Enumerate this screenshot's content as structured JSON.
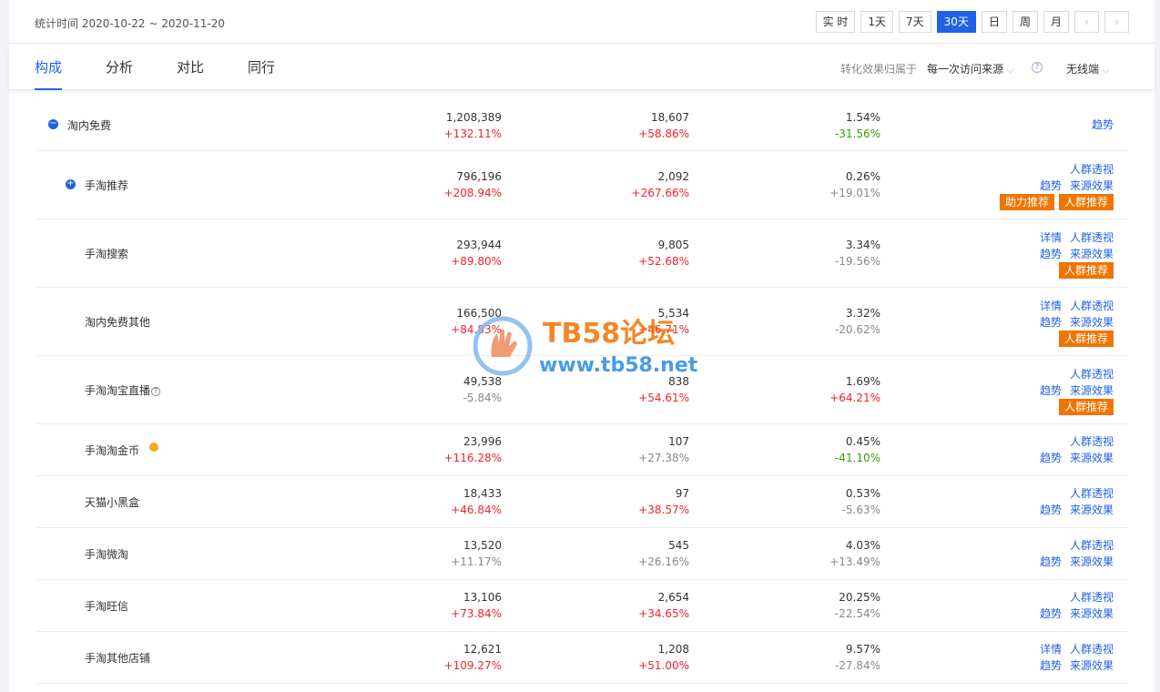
{
  "header": {
    "date_range": "统计时间 2020-10-22 ~ 2020-11-20",
    "range_buttons": [
      {
        "label": "实 时",
        "active": false
      },
      {
        "label": "1天",
        "active": false
      },
      {
        "label": "7天",
        "active": false
      },
      {
        "label": "30天",
        "active": true
      },
      {
        "label": "日",
        "active": false
      },
      {
        "label": "周",
        "active": false
      },
      {
        "label": "月",
        "active": false
      }
    ],
    "prev_icon": "‹",
    "next_icon": "›"
  },
  "tabs": [
    "构成",
    "分析",
    "对比",
    "同行"
  ],
  "attribution": {
    "label": "转化效果归属于",
    "value": "每一次访问来源",
    "device": "无线端"
  },
  "rows": [
    {
      "name": "淘内免费",
      "toggle": "−",
      "v1": "1,208,389",
      "c1": "+132.11%",
      "v2": "18,607",
      "c2": "+58.86%",
      "v3": "1.54%",
      "c3": "-31.56%"
    },
    {
      "name": "手淘推荐",
      "toggle": "+",
      "v1": "796,196",
      "c1": "+208.94%",
      "v2": "2,092",
      "c2": "+267.66%",
      "v3": "0.26%",
      "c3": "+19.01%"
    },
    {
      "name": "手淘搜索",
      "v1": "293,944",
      "c1": "+89.80%",
      "v2": "9,805",
      "c2": "+52.68%",
      "v3": "3.34%",
      "c3": "-19.56%"
    },
    {
      "name": "淘内免费其他",
      "v1": "166,500",
      "c1": "+84.83%",
      "v2": "5,534",
      "c2": "+46.71%",
      "v3": "3.32%",
      "c3": "-20.62%"
    },
    {
      "name": "手淘淘宝直播",
      "v1": "49,538",
      "c1": "-5.84%",
      "v2": "838",
      "c2": "+54.61%",
      "v3": "1.69%",
      "c3": "+64.21%"
    },
    {
      "name": "手淘淘金币",
      "v1": "23,996",
      "c1": "+116.28%",
      "v2": "107",
      "c2": "+27.38%",
      "v3": "0.45%",
      "c3": "-41.10%"
    },
    {
      "name": "天猫小黑盒",
      "v1": "18,433",
      "c1": "+46.84%",
      "v2": "97",
      "c2": "+38.57%",
      "v3": "0.53%",
      "c3": "-5.63%"
    },
    {
      "name": "手淘微淘",
      "v1": "13,520",
      "c1": "+11.17%",
      "v2": "545",
      "c2": "+26.16%",
      "v3": "4.03%",
      "c3": "+13.49%"
    },
    {
      "name": "手淘旺信",
      "v1": "13,106",
      "c1": "+73.84%",
      "v2": "2,654",
      "c2": "+34.65%",
      "v3": "20.25%",
      "c3": "-22.54%"
    },
    {
      "name": "手淘其他店铺",
      "v1": "12,621",
      "c1": "+109.27%",
      "v2": "1,208",
      "c2": "+51.00%",
      "v3": "9.57%",
      "c3": "-27.84%"
    }
  ],
  "links": {
    "trend": "趋势",
    "detail": "详情",
    "crowd": "人群透视",
    "source_effect": "来源效果",
    "boost": "助力推荐",
    "crowd_recommend": "人群推荐"
  },
  "question_icon": "?",
  "watermark": {
    "title": "TB58论坛",
    "url": "www.tb58.net"
  },
  "colors": {
    "accent": "#2062e6",
    "up": "#f5222d",
    "down": "#389e0d",
    "tag": "#f07400",
    "dot": "#f5a623"
  }
}
